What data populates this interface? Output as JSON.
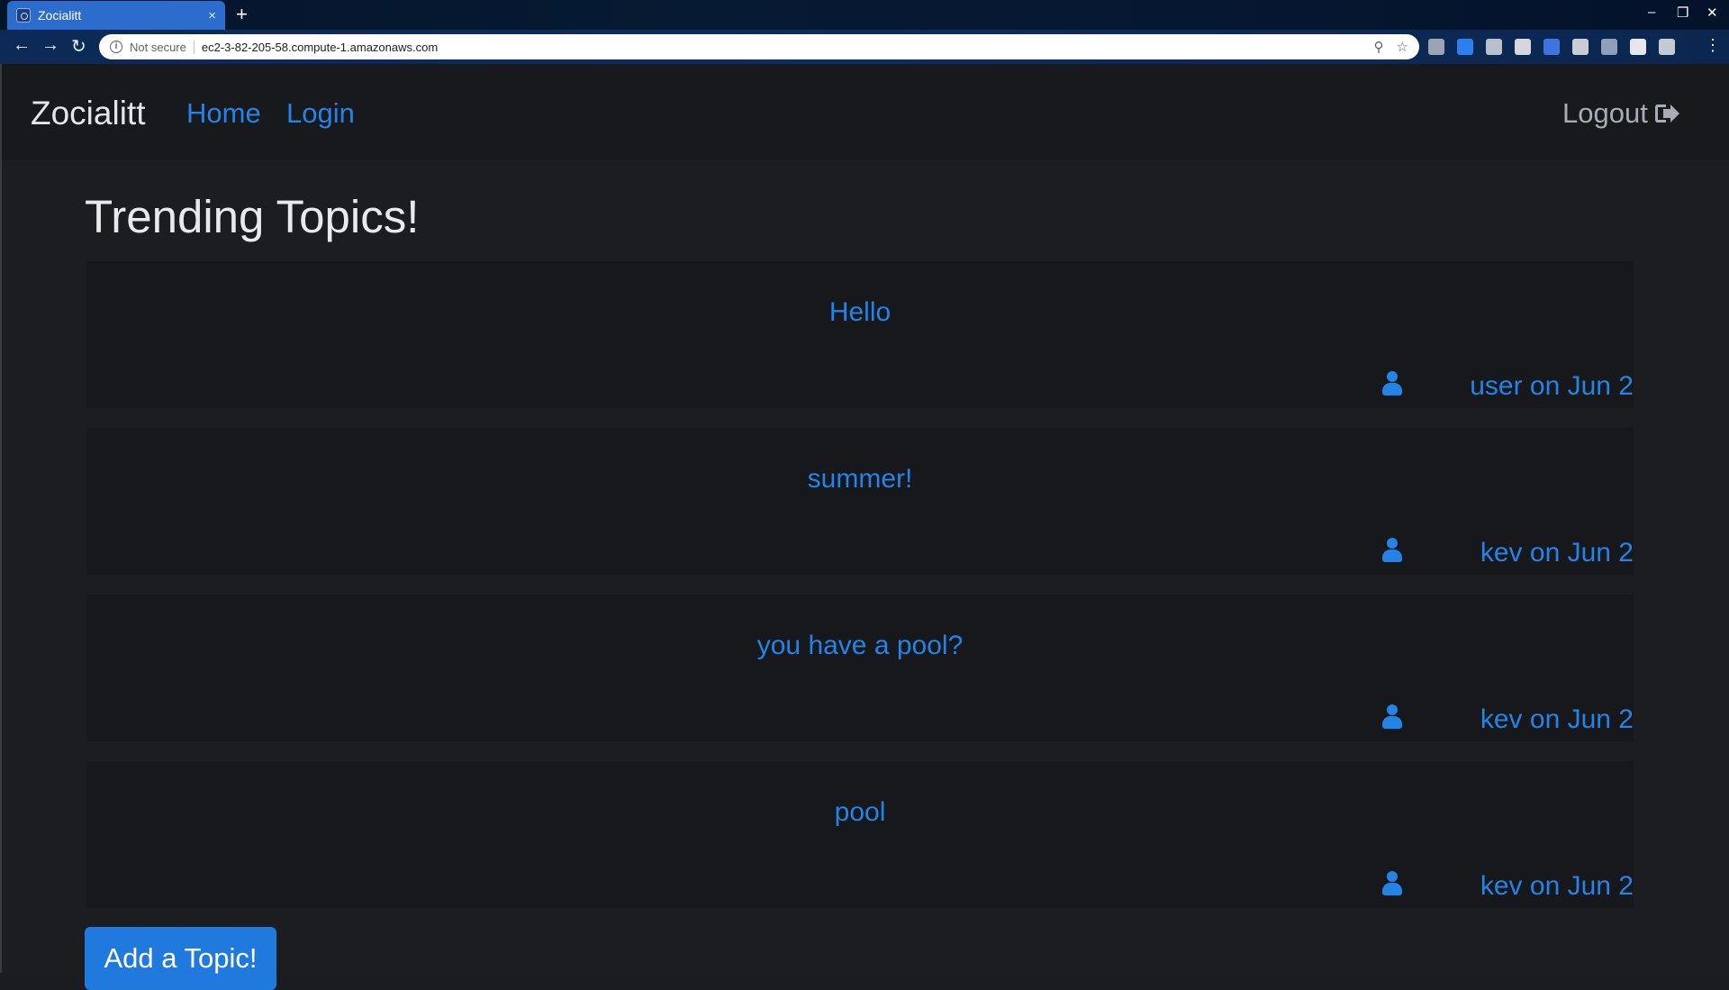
{
  "browser": {
    "tab_title": "Zocialitt",
    "tab_close": "×",
    "new_tab": "+",
    "security_label": "Not secure",
    "url": "ec2-3-82-205-58.compute-1.amazonaws.com",
    "back": "←",
    "forward": "→",
    "reload": "↻",
    "zoom_icon": "⚲",
    "star_icon": "☆",
    "menu": "⋮",
    "minimize": "–",
    "maximize": "❐",
    "close": "✕",
    "info": "i",
    "extension_colors": [
      "#9aa4b5",
      "#2d7ff0",
      "#b8c0cc",
      "#d4d8de",
      "#3f74e0",
      "#c9ced6",
      "#8fa0b8",
      "#e5e7ea",
      "#c4cad3"
    ]
  },
  "navbar": {
    "brand": "Zocialitt",
    "links": [
      "Home",
      "Login"
    ],
    "logout": "Logout"
  },
  "main": {
    "heading": "Trending Topics!",
    "topics": [
      {
        "title": "Hello",
        "meta": "user on Jun 2"
      },
      {
        "title": "summer!",
        "meta": "kev on Jun 2"
      },
      {
        "title": "you have a pool?",
        "meta": "kev on Jun 2"
      },
      {
        "title": "pool",
        "meta": "kev on Jun 2"
      }
    ],
    "add_button": "Add a Topic!"
  },
  "colors": {
    "link": "#2483e6",
    "background": "#1c1d21",
    "card": "#17181b",
    "button": "#2079dc"
  }
}
